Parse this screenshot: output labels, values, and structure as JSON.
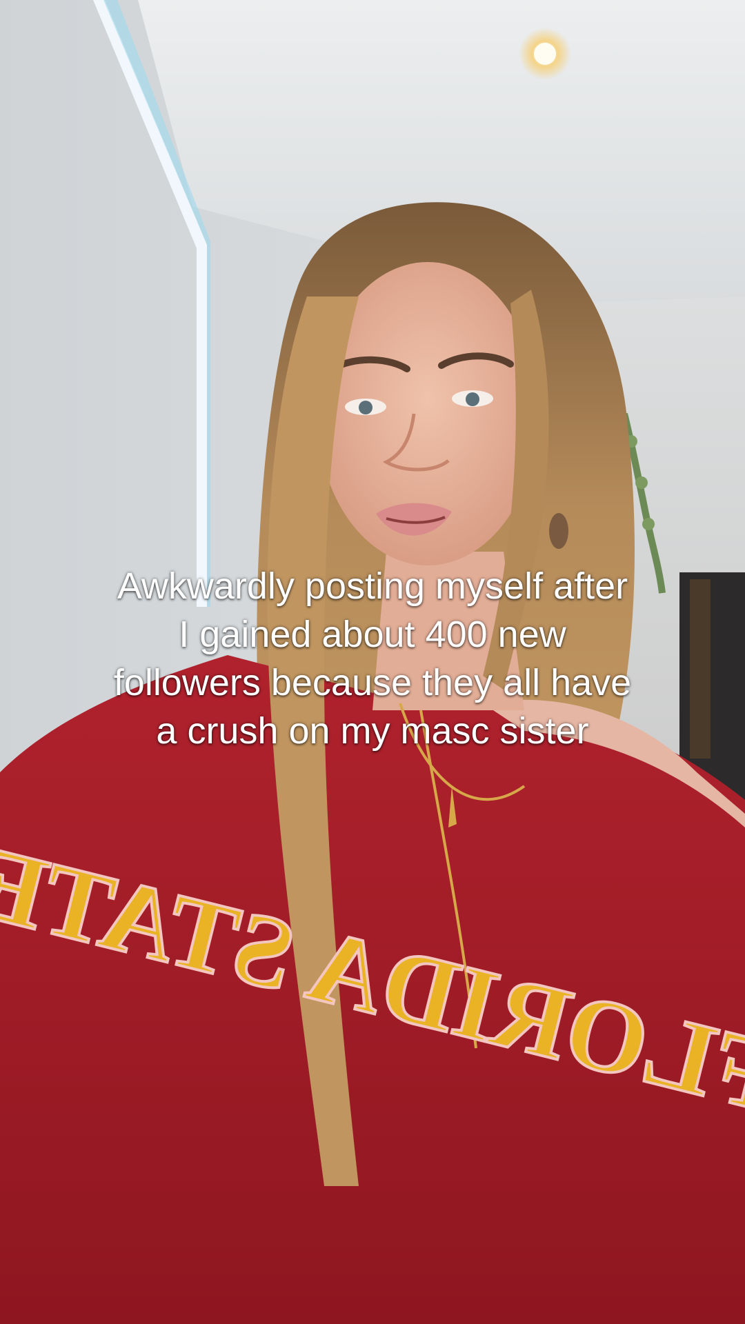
{
  "caption": {
    "lines": [
      "Awkwardly posting myself after",
      "I gained about 400 new",
      "followers because they all have",
      "a crush on my masc sister"
    ]
  },
  "sweatshirt_print": "FLORIDA STATE",
  "colors": {
    "caption_text": "#ffffff",
    "wall": "#d6d9dc",
    "ceiling": "#e4e6e8",
    "sweatshirt": "#a51f2a",
    "sweatshirt_lettering": "#e9b325",
    "hair": "#b48a58",
    "skin": "#e6b8a2"
  }
}
